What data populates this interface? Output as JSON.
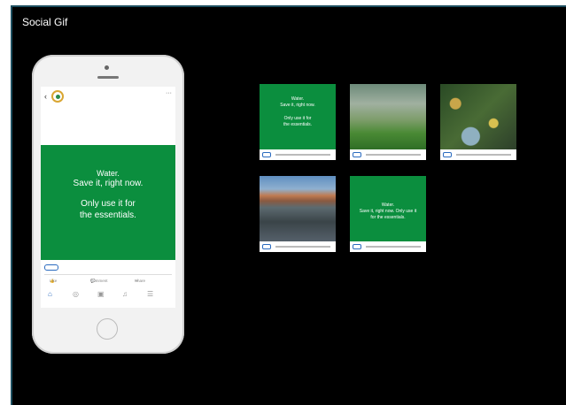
{
  "page": {
    "title": "Social Gif"
  },
  "phone": {
    "post": {
      "back_icon": "chevron-left-icon",
      "account_name": "",
      "account_sub": "",
      "body_text": "",
      "link_text": "",
      "panel": {
        "line1": "Water.",
        "line2": "Save it, right now.",
        "line3": "Only use it for",
        "line4": "the essentials."
      }
    },
    "actions": {
      "like": "Like",
      "comment": "Comment",
      "share": "Share"
    }
  },
  "thumbnails": [
    {
      "kind": "green-text",
      "lines": [
        "Water.",
        "Save it, right now.",
        "Only use it for",
        "the essentials."
      ]
    },
    {
      "kind": "photo-sprinkler"
    },
    {
      "kind": "photo-garden",
      "overlay": ""
    },
    {
      "kind": "photo-lake",
      "overlay": ""
    },
    {
      "kind": "green-text",
      "lines": [
        "Water.",
        "Save it, right now. Only use it",
        "for the essentials."
      ]
    }
  ],
  "colors": {
    "background": "#000000",
    "brand_green": "#0b8e3e",
    "frame_border": "#1d4f60"
  }
}
